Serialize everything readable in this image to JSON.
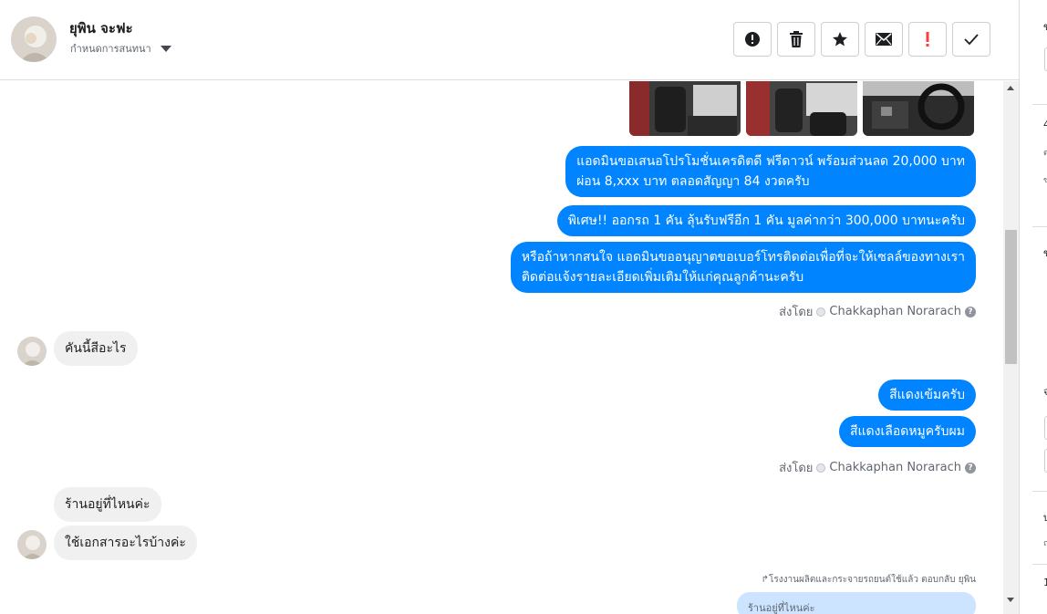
{
  "header": {
    "contact_name": "ยุพิน จะฟะ",
    "assign_label": "กำหนดการสนทนา"
  },
  "toolbar": {
    "icons": [
      "alert-circle-icon",
      "trash-icon",
      "star-icon",
      "envelope-icon",
      "exclamation-icon",
      "check-icon"
    ],
    "accent_colors": {
      "exclamation": "#fa3e3e"
    }
  },
  "colors": {
    "outgoing_bubble": "#0084ff",
    "incoming_bubble": "#f1f0f0",
    "reply_bubble": "#cce4ff"
  },
  "messages": {
    "outgoing_1_line1": "แอดมินขอเสนอโปรโมชั่นเครดิตดี ฟรีดาวน์ พร้อมส่วนลด 20,000 บาท",
    "outgoing_1_line2": "ผ่อน 8,xxx บาท ตลอดสัญญา 84 งวดครับ",
    "outgoing_2": "พิเศษ!! ออกรถ 1 คัน ลุ้นรับฟรีอีก 1 คัน มูลค่ากว่า 300,000 บาทนะครับ",
    "outgoing_3_line1": "หรือถ้าหากสนใจ แอดมินขออนุญาตขอเบอร์โทรติดต่อเพื่อที่จะให้เซลล์ของทางเรา",
    "outgoing_3_line2": "ติดต่อแจ้งรายละเอียดเพิ่มเติมให้แก่คุณลูกค้านะครับ",
    "sent_by_label": "ส่งโดย",
    "sent_by_name": "Chakkaphan Norarach",
    "incoming_1": "คันนี้สีอะไร",
    "outgoing_4": "สีแดงเข้มครับ",
    "outgoing_5": "สีแดงเลือดหมูครับผม",
    "incoming_2": "ร้านอยู่ที่ไหนค่ะ",
    "incoming_3": "ใช้เอกสารอะไรบ้างค่ะ",
    "reply_note": "โรงงานผลิตและกระจายรถยนต์ใช้แล้ว ตอบกลับ ยุพิน",
    "reply_quote": "ร้านอยู่ที่ไหนค่ะ"
  },
  "right_strip": {
    "glyphs": [
      "ข",
      "4",
      "ต",
      "ข",
      "ข",
      "จ",
      "บ",
      "ถ",
      "1"
    ]
  }
}
